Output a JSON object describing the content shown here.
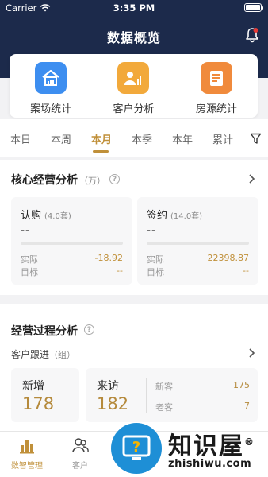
{
  "status_bar": {
    "carrier": "Carrier",
    "time": "3:35 PM"
  },
  "header": {
    "title": "数据概览"
  },
  "quick_actions": [
    {
      "label": "案场统计",
      "icon": "house-chart-icon",
      "color": "#3d8ef0"
    },
    {
      "label": "客户分析",
      "icon": "customer-chart-icon",
      "color": "#f2a93b"
    },
    {
      "label": "房源统计",
      "icon": "document-list-icon",
      "color": "#f08a3c"
    }
  ],
  "period_tabs": [
    "本日",
    "本周",
    "本月",
    "本季",
    "本年",
    "累计"
  ],
  "active_tab": "本月",
  "core": {
    "title": "核心经营分析",
    "unit": "（万）",
    "cards": [
      {
        "title": "认购",
        "count": "(4.0套)",
        "value": "--",
        "actual_label": "实际",
        "actual": "-18.92",
        "target_label": "目标",
        "target": "--"
      },
      {
        "title": "签约",
        "count": "(14.0套)",
        "value": "--",
        "actual_label": "实际",
        "actual": "22398.87",
        "target_label": "目标",
        "target": "--"
      }
    ]
  },
  "process": {
    "title": "经营过程分析",
    "subtitle": "客户跟进",
    "subtitle_unit": "（组）",
    "new": {
      "label": "新增",
      "value": "178"
    },
    "visit": {
      "label": "来访",
      "value": "182",
      "new_label": "新客",
      "new_value": "175",
      "old_label": "老客",
      "old_value": "7"
    }
  },
  "tabbar": [
    {
      "label": "数智管理",
      "active": true
    },
    {
      "label": "客户",
      "active": false
    }
  ],
  "watermark": {
    "title": "知识屋",
    "registered": "®",
    "url": "zhishiwu.com"
  },
  "colors": {
    "header": "#1c2a4b",
    "accent": "#c0903a",
    "notification": "#e53935"
  }
}
